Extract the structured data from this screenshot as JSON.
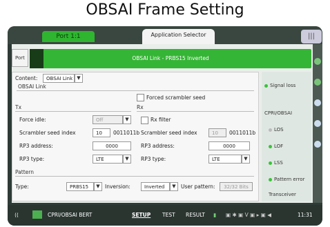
{
  "page_title": "OBSAI Frame Setting",
  "header": {
    "port_tab": "Port 1:1",
    "app_selector": "Application Selector",
    "right_button": "|||"
  },
  "port_button": "Port",
  "status_bar": "OBSAI Link - PRBS15 Inverted",
  "content": {
    "label": "Content:",
    "value": "OBSAI Link"
  },
  "obsai_link_header": "OBSAI Link",
  "forced_scrambler_seed": "Forced scrambler seed",
  "tx": {
    "header": "Tx",
    "force_idle_label": "Force idle:",
    "force_idle_value": "Off",
    "scrambler_seed_index_label": "Scrambler seed index",
    "scrambler_seed_index_value": "10",
    "scrambler_seed_hex": "0011011b",
    "rp3_address_label": "RP3 address:",
    "rp3_address_value": "0000",
    "rp3_type_label": "RP3 type:",
    "rp3_type_value": "LTE"
  },
  "rx": {
    "header": "Rx",
    "rx_filter_label": "Rx filter",
    "scrambler_seed_index_label": "Scrambler seed index",
    "scrambler_seed_index_value": "10",
    "scrambler_seed_hex": "0011011b",
    "rp3_address_label": "RP3 address:",
    "rp3_address_value": "0000",
    "rp3_type_label": "RP3 type:",
    "rp3_type_value": "LTE"
  },
  "pattern": {
    "header": "Pattern",
    "type_label": "Type:",
    "type_value": "PRBS15",
    "inversion_label": "Inversion:",
    "inversion_value": "Inverted",
    "user_pattern_label": "User pattern:",
    "user_pattern_value": "32/32 Bits"
  },
  "side_panel": {
    "signal_loss": "Signal loss",
    "cpri_obsai": "CPRI/OBSAI",
    "los": "LOS",
    "lof": "LOF",
    "lss": "LSS",
    "pattern_error": "Pattern error",
    "transceiver": "Transceiver"
  },
  "bottom_bar": {
    "app_name": "CPRI/OBSAI BERT",
    "setup": "SETUP",
    "test": "TEST",
    "result": "RESULT",
    "time": "11:31"
  },
  "colors": {
    "accent_green": "#35b535",
    "frame_dark": "#2e3b36"
  }
}
